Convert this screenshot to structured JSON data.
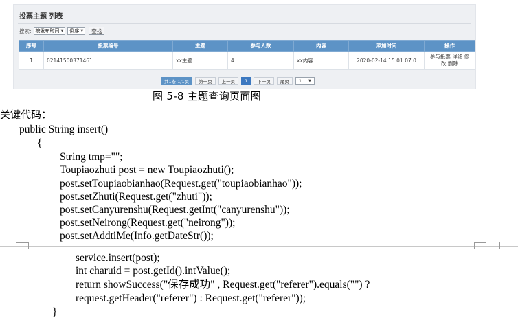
{
  "panel": {
    "title": "投票主题 列表",
    "search": {
      "label": "搜索:",
      "sort_field": "按发布时间",
      "sort_order": "倒序",
      "button": "查找"
    },
    "table": {
      "headers": [
        "序号",
        "投票编号",
        "主题",
        "参与人数",
        "内容",
        "添加时间",
        "操作"
      ],
      "rows": [
        {
          "index": "1",
          "code": "02141500371461",
          "topic": "xx主题",
          "participants": "4",
          "content": "xx内容",
          "added": "2020-02-14 15:01:07.0",
          "ops_line1": "参与投票 详细 修",
          "ops_line2": "改 删除"
        }
      ]
    },
    "pager": {
      "info": "共1条  1/1页",
      "first": "第一页",
      "prev": "上一页",
      "current": "1",
      "next": "下一页",
      "last": "尾页",
      "jump": "1"
    }
  },
  "caption": "图 5-8 主题查询页面图",
  "key_code_label": "关键代码：",
  "code_top": [
    "public String insert()",
    "{",
    "String tmp=\"\";",
    "Toupiaozhuti post = new Toupiaozhuti();",
    "post.setToupiaobianhao(Request.get(\"toupiaobianhao\"));",
    "post.setZhuti(Request.get(\"zhuti\"));",
    "post.setCanyurenshu(Request.getInt(\"canyurenshu\"));",
    "post.setNeirong(Request.get(\"neirong\"));",
    "post.setAddtiMe(Info.getDateStr());"
  ],
  "code_bottom": [
    "service.insert(post);",
    "int charuid = post.getId().intValue();",
    "return showSuccess(\"保存成功\" , Request.get(\"referer\").equals(\"\") ?",
    "request.getHeader(\"referer\") : Request.get(\"referer\"));",
    "}"
  ]
}
